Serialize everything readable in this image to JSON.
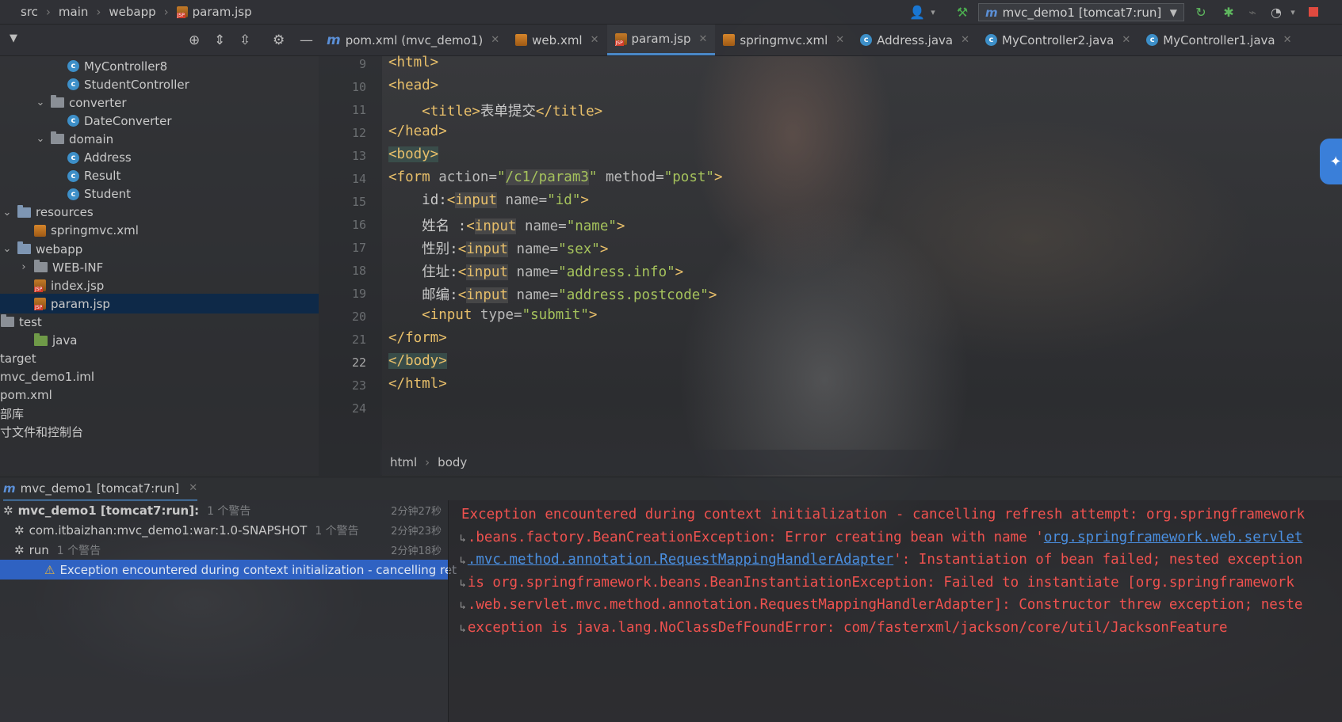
{
  "breadcrumb": [
    "src",
    "main",
    "webapp",
    "param.jsp"
  ],
  "run_config": {
    "prefix": "m",
    "label": "mvc_demo1 [tomcat7:run]"
  },
  "project_tree": [
    {
      "label": "MyController8",
      "icon": "class-icon",
      "indent": 3,
      "chev": ""
    },
    {
      "label": "StudentController",
      "icon": "class-icon",
      "indent": 3,
      "chev": ""
    },
    {
      "label": "converter",
      "icon": "folder-icon",
      "indent": 2,
      "chev": "v"
    },
    {
      "label": "DateConverter",
      "icon": "class-icon",
      "indent": 3,
      "chev": ""
    },
    {
      "label": "domain",
      "icon": "folder-icon",
      "indent": 2,
      "chev": "v"
    },
    {
      "label": "Address",
      "icon": "class-icon",
      "indent": 3,
      "chev": ""
    },
    {
      "label": "Result",
      "icon": "class-icon",
      "indent": 3,
      "chev": ""
    },
    {
      "label": "Student",
      "icon": "class-icon",
      "indent": 3,
      "chev": ""
    },
    {
      "label": "resources",
      "icon": "folder-icon",
      "indent": 0,
      "chev": "v"
    },
    {
      "label": "springmvc.xml",
      "icon": "xml-icon",
      "indent": 1,
      "chev": ""
    },
    {
      "label": "webapp",
      "icon": "folder-icon",
      "indent": 0,
      "chev": "v"
    },
    {
      "label": "WEB-INF",
      "icon": "folder-icon",
      "indent": 1,
      "chev": ">"
    },
    {
      "label": "index.jsp",
      "icon": "jsp-icon",
      "indent": 1,
      "chev": ""
    },
    {
      "label": "param.jsp",
      "icon": "jsp-icon",
      "indent": 1,
      "chev": "",
      "selected": true
    },
    {
      "label": "test",
      "icon": "folder-icon",
      "indent": -1,
      "chev": ""
    },
    {
      "label": "java",
      "icon": "folder-icon",
      "indent": 1,
      "chev": ""
    },
    {
      "label": "target",
      "icon": "",
      "indent": -2,
      "chev": ""
    },
    {
      "label": "mvc_demo1.iml",
      "icon": "",
      "indent": -2,
      "chev": ""
    },
    {
      "label": "pom.xml",
      "icon": "",
      "indent": -2,
      "chev": ""
    },
    {
      "label": "部库",
      "icon": "",
      "indent": -2,
      "chev": ""
    },
    {
      "label": "寸文件和控制台",
      "icon": "",
      "indent": -2,
      "chev": ""
    }
  ],
  "tabs": [
    {
      "label": "pom.xml (mvc_demo1)",
      "icon": "maven-icon"
    },
    {
      "label": "web.xml",
      "icon": "xml-icon"
    },
    {
      "label": "param.jsp",
      "icon": "jsp-icon",
      "active": true
    },
    {
      "label": "springmvc.xml",
      "icon": "xml-icon"
    },
    {
      "label": "Address.java",
      "icon": "class-icon"
    },
    {
      "label": "MyController2.java",
      "icon": "class-icon"
    },
    {
      "label": "MyController1.java",
      "icon": "class-icon"
    }
  ],
  "line_numbers": [
    "9",
    "10",
    "11",
    "12",
    "13",
    "14",
    "15",
    "16",
    "17",
    "18",
    "19",
    "20",
    "21",
    "22",
    "23",
    "24"
  ],
  "code": {
    "l9": "<html>",
    "l10": "<head>",
    "l11_open": "<title>",
    "l11_text": "表单提交",
    "l11_close": "</title>",
    "l12": "</head>",
    "l13": "<body>",
    "l14_tag": "<form",
    "l14_attr1": " action=",
    "l14_q1": "\"",
    "l14_val1": "/c1/param3",
    "l14_q2": "\"",
    "l14_attr2": " method=",
    "l14_val2": "\"post\"",
    "l14_end": ">",
    "l15_label": "id:",
    "l15_name": "\"id\"",
    "l16_label": "姓名 :",
    "l16_name": "\"name\"",
    "l17_label": "性别:",
    "l17_name": "\"sex\"",
    "l18_label": "住址:",
    "l18_name": "\"address.info\"",
    "l19_label": "邮编:",
    "l19_name": "\"address.postcode\"",
    "l20_tag": "<input",
    "l20_attr": " type=",
    "l20_val": "\"submit\"",
    "l20_end": ">",
    "input_tag": "<input",
    "name_attr": " name=",
    "close": ">",
    "lt": "<",
    "input_word": "input",
    "l21": "</form>",
    "l22": "</body>",
    "l23": "</html>"
  },
  "editor_breadcrumb": [
    "html",
    "body"
  ],
  "run_tab": {
    "prefix": "m",
    "label": "mvc_demo1 [tomcat7:run]"
  },
  "run_tree": [
    {
      "label": "mvc_demo1 [tomcat7:run]:",
      "warn": "1 个警告",
      "time": "2分钟27秒",
      "bold": true
    },
    {
      "label": "com.itbaizhan:mvc_demo1:war:1.0-SNAPSHOT",
      "warn": "1 个警告",
      "time": "2分钟23秒"
    },
    {
      "label": "run",
      "warn": "1 个警告",
      "time": "2分钟18秒"
    },
    {
      "label": "Exception encountered during context initialization - cancelling ret",
      "warn": "",
      "time": "",
      "selected": true
    }
  ],
  "console_lines": [
    {
      "wrap": false,
      "pre": "Exception encountered during context initialization - cancelling refresh attempt: org.springframework",
      "link": "",
      "post": ""
    },
    {
      "wrap": true,
      "pre": ".beans.factory.BeanCreationException: Error creating bean with name '",
      "link": "org.springframework.web.servlet",
      "post": ""
    },
    {
      "wrap": true,
      "pre": "",
      "link": ".mvc.method.annotation.RequestMappingHandlerAdapter",
      "post": "': Instantiation of bean failed; nested exception"
    },
    {
      "wrap": true,
      "pre": "is org.springframework.beans.BeanInstantiationException: Failed to instantiate [org.springframework",
      "link": "",
      "post": ""
    },
    {
      "wrap": true,
      "pre": ".web.servlet.mvc.method.annotation.RequestMappingHandlerAdapter]: Constructor threw exception; neste",
      "link": "",
      "post": ""
    },
    {
      "wrap": true,
      "pre": "exception is java.lang.NoClassDefFoundError: com/fasterxml/jackson/core/util/JacksonFeature",
      "link": "",
      "post": ""
    }
  ],
  "colors": {
    "accent": "#4a88c7",
    "error": "#f0524f",
    "tag": "#e8bf6a",
    "string": "#a5c25c"
  }
}
